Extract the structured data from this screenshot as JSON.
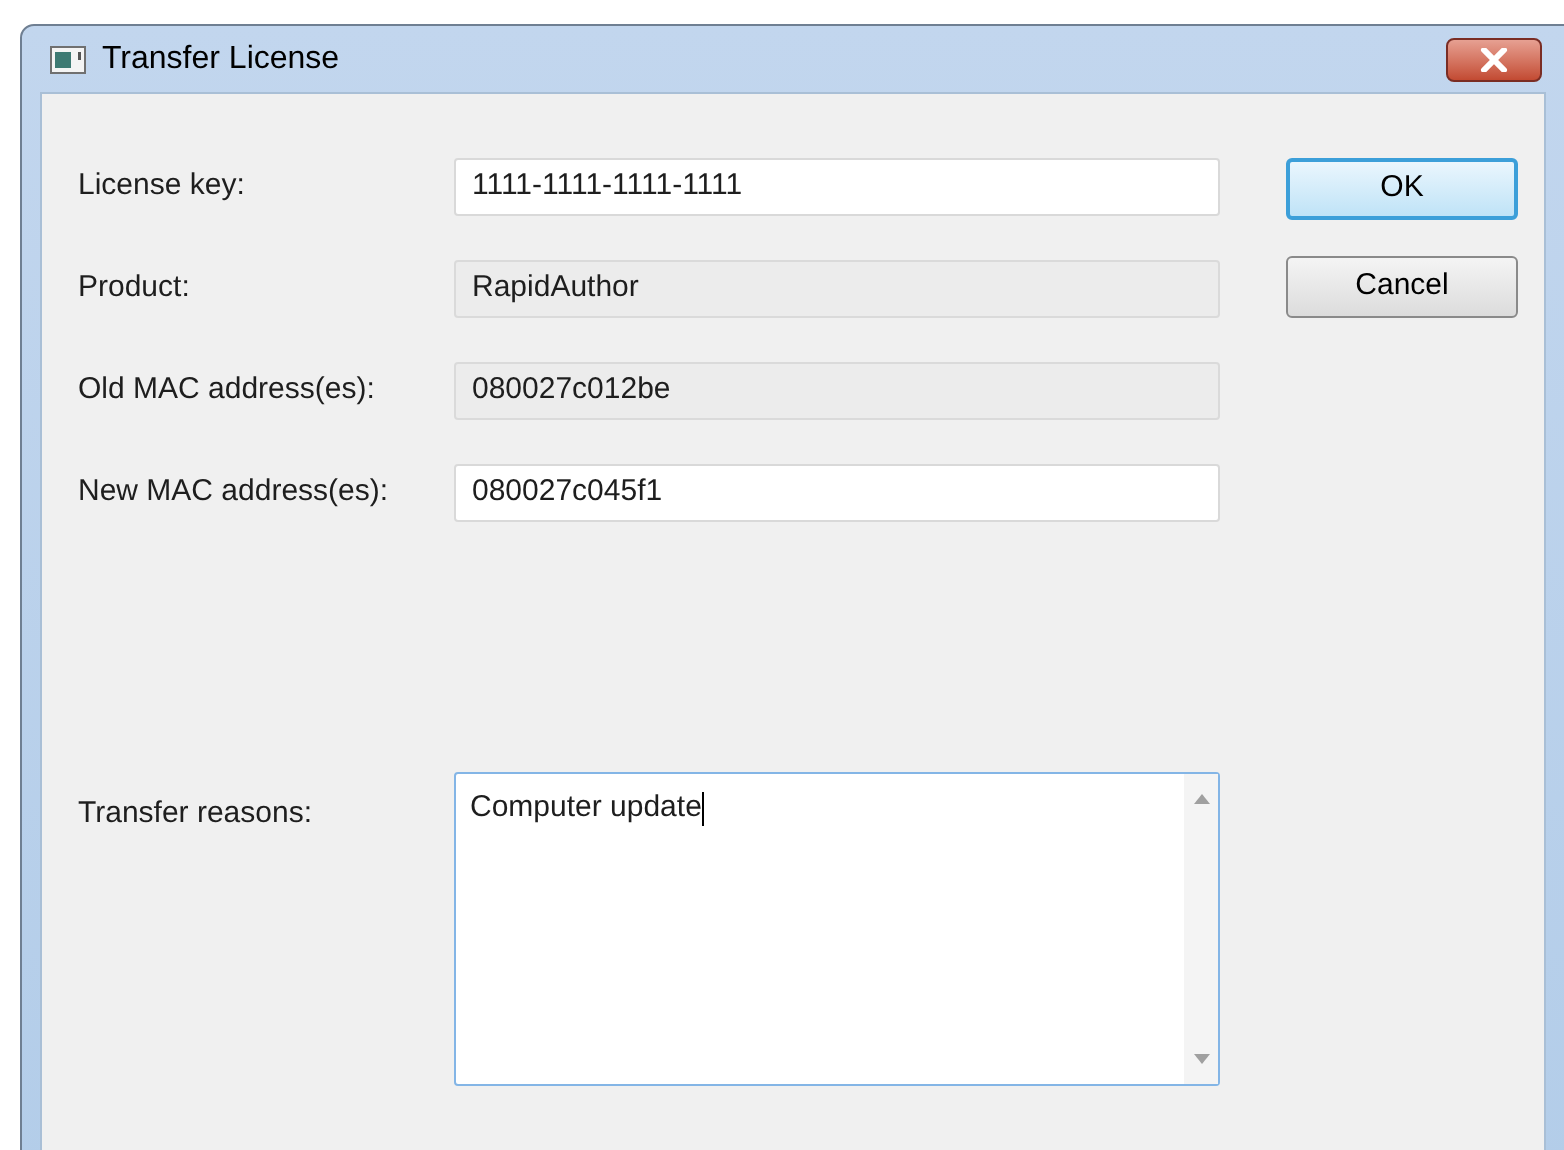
{
  "window": {
    "title": "Transfer License"
  },
  "fields": [
    {
      "label": "License key:",
      "value": "1111-1111-1111-1111",
      "read_only": false
    },
    {
      "label": "Product:",
      "value": "RapidAuthor",
      "read_only": true
    },
    {
      "label": "Old MAC address(es):",
      "value": "080027c012be",
      "read_only": true
    },
    {
      "label": "New MAC address(es):",
      "value": "080027c045f1",
      "read_only": false
    }
  ],
  "reasons": {
    "label": "Transfer reasons:",
    "value": "Computer update",
    "focused": true
  },
  "buttons": [
    {
      "label": "OK",
      "default": true
    },
    {
      "label": "Cancel",
      "default": false
    }
  ]
}
